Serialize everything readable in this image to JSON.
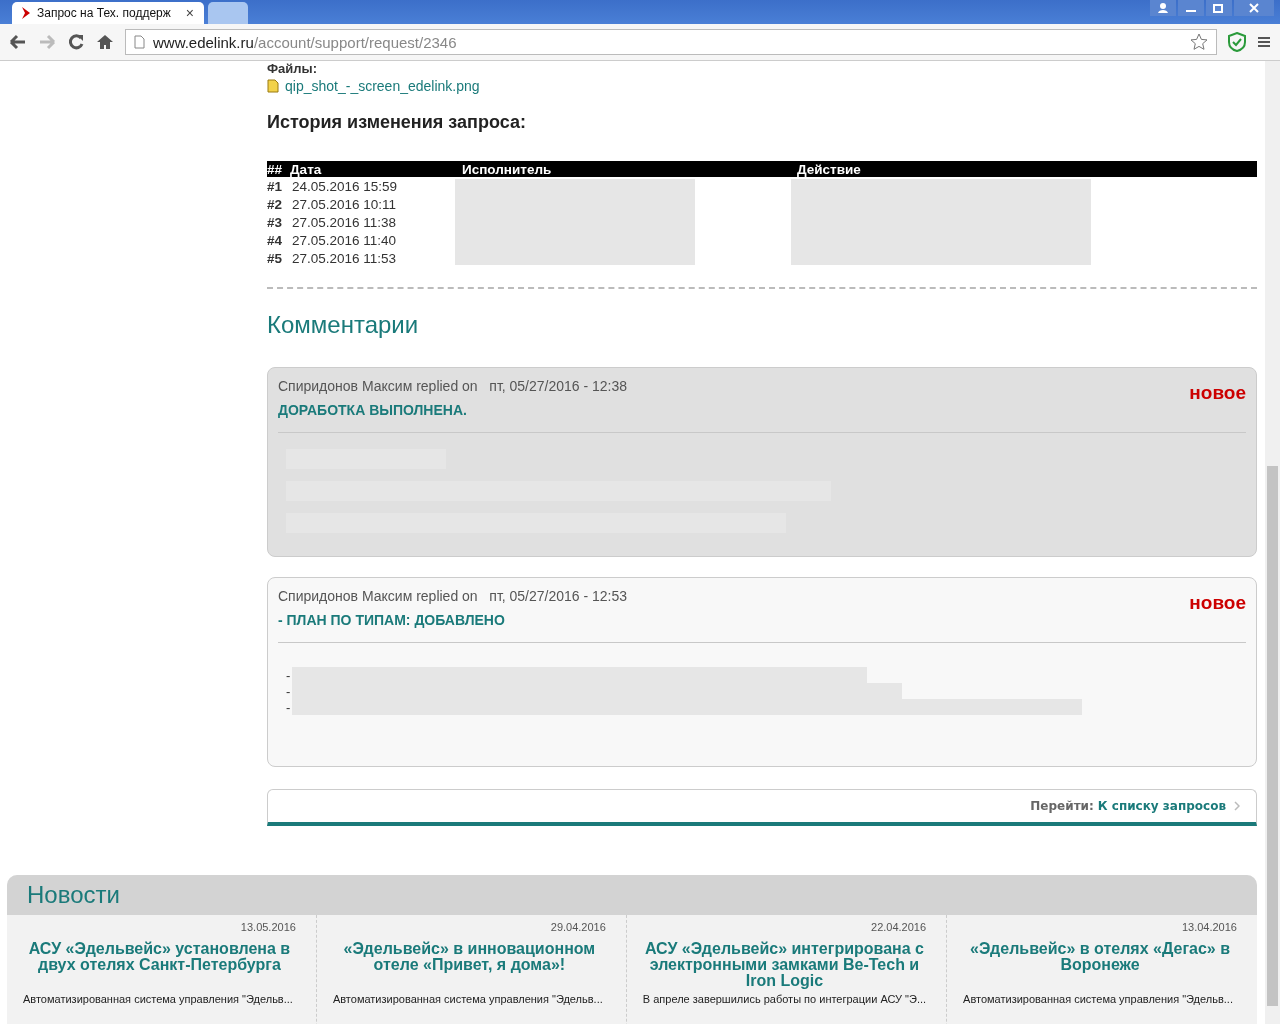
{
  "browser": {
    "tabs": [
      {
        "title": "Запрос на Тех. поддерж",
        "selected": true,
        "close": "×"
      },
      {
        "selected": false
      }
    ],
    "url": {
      "host": "www.edelink.ru",
      "path": "/account/support/request/2346"
    }
  },
  "files": {
    "label": "Файлы:",
    "items": [
      "qip_shot_-_screen_edelink.png"
    ]
  },
  "history": {
    "title": "История изменения запроса:",
    "columns": [
      "##",
      "Дата",
      "Исполнитель",
      "Действие"
    ],
    "rows": [
      {
        "num": "#1",
        "date": "24.05.2016 15:59"
      },
      {
        "num": "#2",
        "date": "27.05.2016 10:11"
      },
      {
        "num": "#3",
        "date": "27.05.2016 11:38"
      },
      {
        "num": "#4",
        "date": "27.05.2016 11:40"
      },
      {
        "num": "#5",
        "date": "27.05.2016 11:53"
      }
    ]
  },
  "comments": {
    "title": "Комментарии",
    "items": [
      {
        "author": "Спиридонов Максим",
        "replied": "replied on",
        "date": "пт, 05/27/2016 - 12:38",
        "badge": "новое",
        "subject": "ДОРАБОТКА ВЫПОЛНЕНА.",
        "highlighted": true,
        "kind": "paragraphs"
      },
      {
        "author": "Спиридонов Максим",
        "replied": "replied on",
        "date": "пт, 05/27/2016 - 12:53",
        "badge": "новое",
        "subject": "- ПЛАН ПО ТИПАМ: ДОБАВЛЕНО",
        "highlighted": false,
        "kind": "list",
        "bullets": [
          "-",
          "-",
          "-"
        ]
      }
    ]
  },
  "nav": {
    "label": "Перейти:",
    "link": "К списку запросов"
  },
  "news": {
    "title": "Новости",
    "items": [
      {
        "date": "13.05.2016",
        "title": "АСУ «Эдельвейс» установлена в двух отелях Санкт-Петербурга",
        "excerpt": "Автоматизированная система управления \"Эдельв..."
      },
      {
        "date": "29.04.2016",
        "title": "«Эдельвейс» в инновационном отеле «Привет, я дома»!",
        "excerpt": "Автоматизированная система управления \"Эдельв..."
      },
      {
        "date": "22.04.2016",
        "title": "АСУ «Эдельвейс» интегрирована с электронными замками Be-Tech и Iron Logic",
        "excerpt": "В апреле завершились работы по интеграции АСУ \"Э..."
      },
      {
        "date": "13.04.2016",
        "title": "«Эдельвейс» в отелях «Дегас» в Воронеже",
        "excerpt": "Автоматизированная система управления \"Эдельв..."
      }
    ]
  }
}
